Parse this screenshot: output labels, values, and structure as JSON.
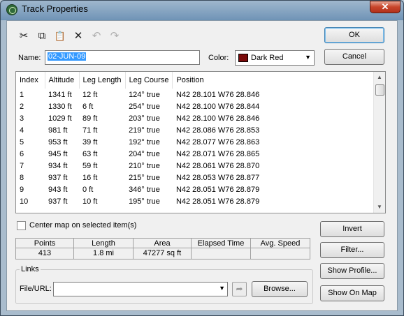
{
  "window": {
    "title": "Track Properties",
    "close_label": "✕"
  },
  "toolbar": {
    "cut_icon": "✂",
    "copy_icon": "⧉",
    "paste_icon": "📋",
    "delete_icon": "✕",
    "undo_icon": "↶",
    "redo_icon": "↷"
  },
  "name_field": {
    "label": "Name:",
    "value": "02-JUN-09"
  },
  "color": {
    "label": "Color:",
    "value": "Dark Red",
    "swatch": "#7b0a0a"
  },
  "buttons": {
    "ok": "OK",
    "cancel": "Cancel",
    "invert": "Invert",
    "filter": "Filter...",
    "show_profile": "Show Profile...",
    "show_on_map": "Show On Map",
    "browse": "Browse..."
  },
  "table": {
    "columns": [
      "Index",
      "Altitude",
      "Leg Length",
      "Leg Course",
      "Position"
    ],
    "rows": [
      [
        "1",
        "1341 ft",
        "12 ft",
        "124° true",
        "N42 28.101 W76 28.846"
      ],
      [
        "2",
        "1330 ft",
        "6 ft",
        "254° true",
        "N42 28.100 W76 28.844"
      ],
      [
        "3",
        "1029 ft",
        "89 ft",
        "203° true",
        "N42 28.100 W76 28.846"
      ],
      [
        "4",
        "981 ft",
        "71 ft",
        "219° true",
        "N42 28.086 W76 28.853"
      ],
      [
        "5",
        "953 ft",
        "39 ft",
        "192° true",
        "N42 28.077 W76 28.863"
      ],
      [
        "6",
        "945 ft",
        "63 ft",
        "204° true",
        "N42 28.071 W76 28.865"
      ],
      [
        "7",
        "934 ft",
        "59 ft",
        "210° true",
        "N42 28.061 W76 28.870"
      ],
      [
        "8",
        "937 ft",
        "16 ft",
        "215° true",
        "N42 28.053 W76 28.877"
      ],
      [
        "9",
        "943 ft",
        "0 ft",
        "346° true",
        "N42 28.051 W76 28.879"
      ],
      [
        "10",
        "937 ft",
        "10 ft",
        "195° true",
        "N42 28.051 W76 28.879"
      ]
    ]
  },
  "center_map": {
    "label": "Center map on selected item(s)",
    "checked": false
  },
  "stats": {
    "headers": [
      "Points",
      "Length",
      "Area",
      "Elapsed Time",
      "Avg. Speed"
    ],
    "values": [
      "413",
      "1.8 mi",
      "47277 sq ft",
      "",
      ""
    ]
  },
  "links": {
    "group_label": "Links",
    "file_url_label": "File/URL:",
    "value": ""
  }
}
